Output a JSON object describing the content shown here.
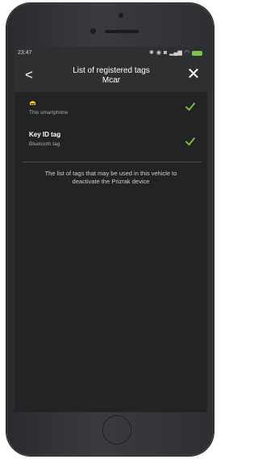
{
  "status_bar": {
    "time": "23:47",
    "icons": [
      "bluetooth-icon",
      "location-icon",
      "alarm-icon",
      "signal-icon",
      "wifi-icon",
      "battery-icon"
    ],
    "battery_color": "#7cc545"
  },
  "header": {
    "title_line1": "List of registered tags",
    "title_line2": "Mcar",
    "back_label": "<",
    "close_label": "✕"
  },
  "tags": [
    {
      "name": "",
      "subtitle": "This smartphone",
      "icon": "tag-icon",
      "checked": true
    },
    {
      "name": "Key ID tag",
      "subtitle": "Bluetooth tag",
      "checked": true
    }
  ],
  "info_text_line1": "The list of tags that may be used in this vehicle to",
  "info_text_line2": "deactivate the Prizrak device",
  "colors": {
    "accent_check": "#7cc545",
    "screen_bg": "#232325",
    "header_bg": "#2e2f31",
    "tag_icon": "#e9c53b"
  }
}
